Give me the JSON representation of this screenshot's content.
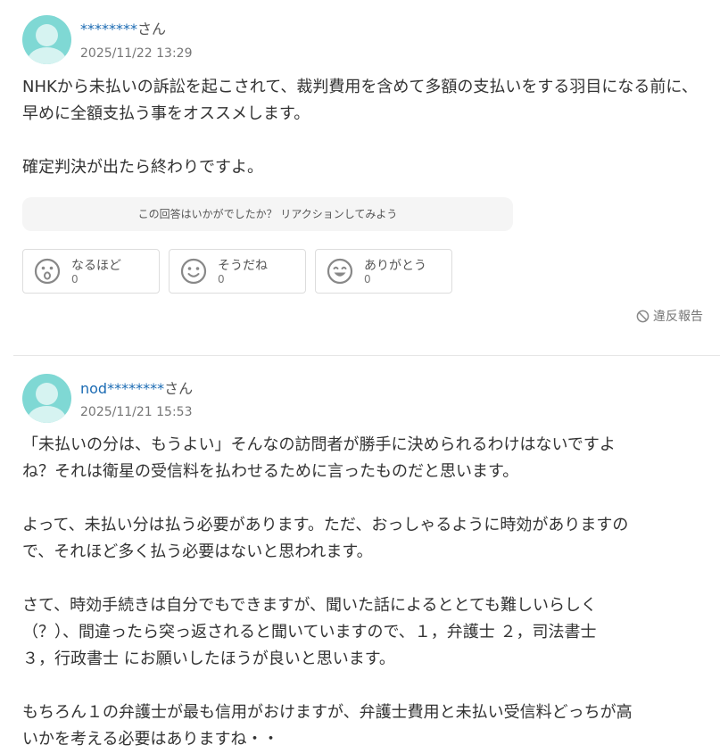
{
  "answers": [
    {
      "user": "********",
      "suffix": "さん",
      "date": "2025/11/22 13:29",
      "paragraphs": [
        "NHKから未払いの訴訟を起こされて、裁判費用を含めて多額の支払いをする羽目になる前に、早めに全額支払う事をオススメします。",
        "確定判決が出たら終わりですよ。"
      ],
      "reaction_prompt": "この回答はいかがでしたか？ リアクションしてみよう",
      "reactions": [
        {
          "label": "なるほど",
          "count": "0",
          "icon": "surprised-face-icon"
        },
        {
          "label": "そうだね",
          "count": "0",
          "icon": "smile-face-icon"
        },
        {
          "label": "ありがとう",
          "count": "0",
          "icon": "grin-face-icon"
        }
      ],
      "report": "違反報告"
    },
    {
      "user": "nod********",
      "suffix": "さん",
      "date": "2025/11/21 15:53",
      "lines": [
        "「未払いの分は、もうよい」そんなの訪問者が勝手に決められるわけはないですよ",
        "ね？それは衛星の受信料を払わせるために言ったものだと思います。",
        "",
        "よって、未払い分は払う必要があります。ただ、おっしゃるように時効がありますの",
        "で、それほど多く払う必要はないと思われます。",
        "",
        "さて、時効手続きは自分でもできますが、聞いた話によるととても難しいらしく",
        "（？）、間違ったら突っ返されると聞いていますので、１，弁護士 ２，司法書士",
        "３，行政書士 にお願いしたほうが良いと思います。",
        "",
        "もちろん１の弁護士が最も信用がおけますが、弁護士費用と未払い受信料どっちが高",
        "いかを考える必要はありますね・・"
      ]
    }
  ],
  "colors": {
    "username": "#1b6bb3",
    "avatar": "#7fd8d4",
    "text": "#333333",
    "muted": "#767676"
  }
}
